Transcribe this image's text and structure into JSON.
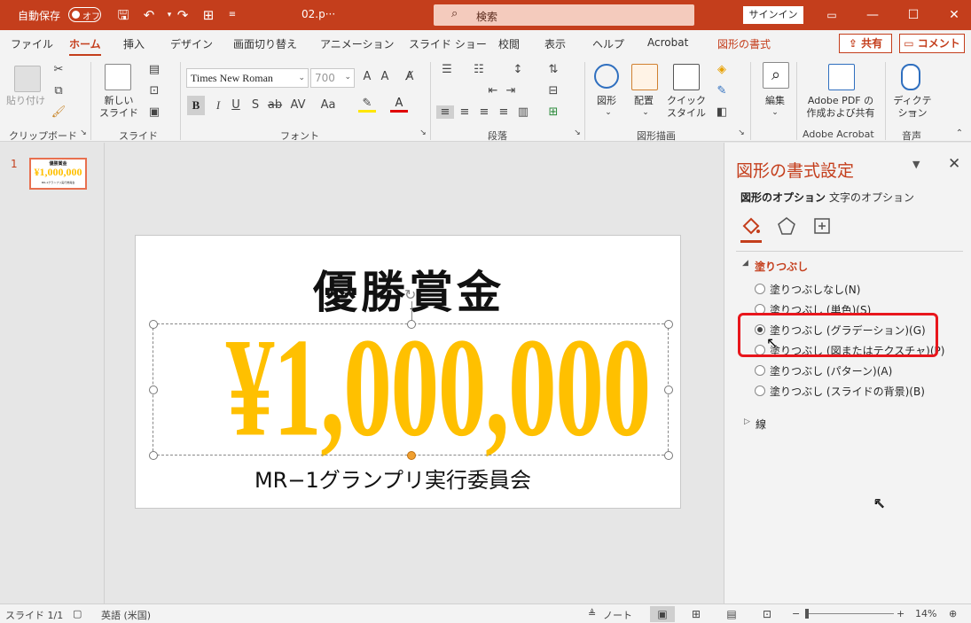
{
  "titlebar": {
    "autosave_label": "自動保存",
    "autosave_state": "オフ",
    "filename": "02.p···",
    "search_placeholder": "検索",
    "signin": "サインイン"
  },
  "tabs": {
    "file": "ファイル",
    "home": "ホーム",
    "insert": "挿入",
    "design": "デザイン",
    "transitions": "画面切り替え",
    "animations": "アニメーション",
    "slideshow": "スライド ショー",
    "review": "校閲",
    "view": "表示",
    "help": "ヘルプ",
    "acrobat": "Acrobat",
    "shape_format": "図形の書式",
    "share": "共有",
    "comment": "コメント"
  },
  "ribbon": {
    "paste": "貼り付け",
    "new_slide_1": "新しい",
    "new_slide_2": "スライド",
    "font_name": "Times New Roman",
    "font_size": "700",
    "shapes": "図形",
    "arrange": "配置",
    "quick_styles_1": "クイック",
    "quick_styles_2": "スタイル",
    "edit": "編集",
    "adobe_pdf_1": "Adobe PDF の",
    "adobe_pdf_2": "作成および共有",
    "dictate_1": "ディクテー",
    "dictate_2": "ション",
    "groups": {
      "clipboard": "クリップボード",
      "slides": "スライド",
      "font": "フォント",
      "paragraph": "段落",
      "drawing": "図形描画",
      "adobe": "Adobe Acrobat",
      "voice": "音声"
    }
  },
  "thumbnail": {
    "number": "1",
    "mini_title": "優勝賞金",
    "mini_amount": "¥1,000,000",
    "mini_footer": "MR-1グランプリ実行委員会"
  },
  "slide": {
    "title": "優勝賞金",
    "amount": "¥1,000,000",
    "footer": "MR−1グランプリ実行委員会"
  },
  "format_pane": {
    "title": "図形の書式設定",
    "tab_shape": "図形のオプション",
    "tab_text": "文字のオプション",
    "section_fill": "塗りつぶし",
    "options": [
      {
        "label": "塗りつぶしなし(N)",
        "selected": false
      },
      {
        "label": "塗りつぶし (単色)(S)",
        "selected": false
      },
      {
        "label": "塗りつぶし (グラデーション)(G)",
        "selected": true
      },
      {
        "label": "塗りつぶし (図またはテクスチャ)(P)",
        "selected": false
      },
      {
        "label": "塗りつぶし (パターン)(A)",
        "selected": false
      },
      {
        "label": "塗りつぶし (スライドの背景)(B)",
        "selected": false
      }
    ],
    "section_line": "線"
  },
  "statusbar": {
    "slide_info": "スライド 1/1",
    "language": "英語 (米国)",
    "notes": "ノート",
    "zoom": "14%"
  },
  "colors": {
    "accent": "#c43e1c",
    "amount": "#ffc000",
    "highlight": "#e8161c"
  }
}
